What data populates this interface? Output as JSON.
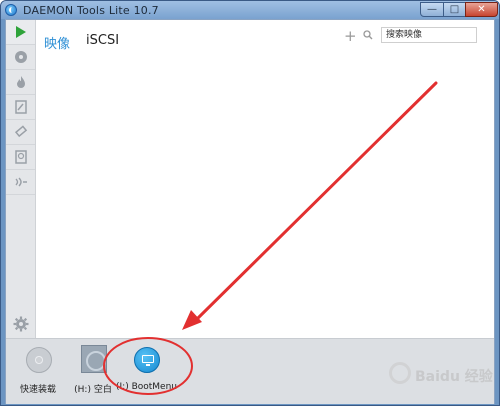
{
  "window": {
    "title": "DAEMON Tools Lite 10.7",
    "controls": {
      "minimize": "—",
      "maximize": "□",
      "close": "✕"
    }
  },
  "tabs": [
    {
      "label": "映像",
      "active": true
    },
    {
      "label": "iSCSI",
      "active": false
    }
  ],
  "search": {
    "value": "搜索映像"
  },
  "sidebar": {
    "items": [
      {
        "icon": "play-icon",
        "active": true
      },
      {
        "icon": "disc-icon"
      },
      {
        "icon": "flame-icon"
      },
      {
        "icon": "image-editor-icon"
      },
      {
        "icon": "usb-icon"
      },
      {
        "icon": "hard-disk-icon"
      },
      {
        "icon": "network-icon"
      }
    ],
    "settings_icon": "gear-icon"
  },
  "dock": {
    "items": [
      {
        "label": "快速装载",
        "icon": "quick-mount-disc-icon"
      },
      {
        "label": "(H:) 空白",
        "icon": "virtual-drive-icon"
      },
      {
        "label": "(I:) BootMenu",
        "icon": "monitor-icon"
      }
    ]
  },
  "watermark": {
    "text": "Baidu 经验"
  },
  "colors": {
    "accent": "#2d8fd5",
    "annotation": "#e23030",
    "play": "#2ea33a"
  }
}
